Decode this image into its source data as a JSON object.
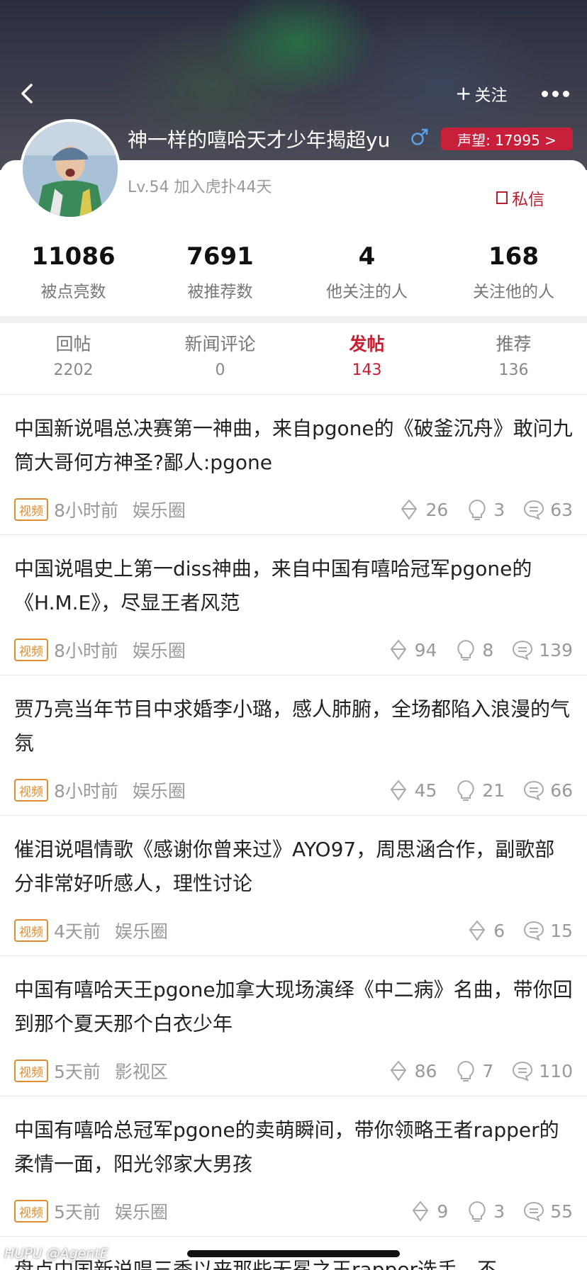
{
  "header": {
    "follow_label": "关注",
    "username": "神一样的嘻哈天才少年揭超yu",
    "reputation_label": "声望: 17995 >",
    "level_line": "Lv.54 加入虎扑44天",
    "dm_label": "私信"
  },
  "stats": [
    {
      "num": "11086",
      "label": "被点亮数"
    },
    {
      "num": "7691",
      "label": "被推荐数"
    },
    {
      "num": "4",
      "label": "他关注的人"
    },
    {
      "num": "168",
      "label": "关注他的人"
    }
  ],
  "tabs": [
    {
      "label": "回帖",
      "count": "2202"
    },
    {
      "label": "新闻评论",
      "count": "0"
    },
    {
      "label": "发帖",
      "count": "143"
    },
    {
      "label": "推荐",
      "count": "136"
    }
  ],
  "active_tab": "发帖",
  "posts": [
    {
      "title": "中国新说唱总决赛第一神曲，来自pgone的《破釜沉舟》敢问九筒大哥何方神圣?鄙人:pgone",
      "tag": "视频",
      "time": "8小时前",
      "section": "娱乐圈",
      "recommend": "26",
      "light": "3",
      "replies": "63"
    },
    {
      "title": "中国说唱史上第一diss神曲，来自中国有嘻哈冠军pgone的《H.M.E》，尽显王者风范",
      "tag": "视频",
      "time": "8小时前",
      "section": "娱乐圈",
      "recommend": "94",
      "light": "8",
      "replies": "139"
    },
    {
      "title": "贾乃亮当年节目中求婚李小璐，感人肺腑，全场都陷入浪漫的气氛",
      "tag": "视频",
      "time": "8小时前",
      "section": "娱乐圈",
      "recommend": "45",
      "light": "21",
      "replies": "66"
    },
    {
      "title": "催泪说唱情歌《感谢你曾来过》AYO97，周思涵合作，副歌部分非常好听感人，理性讨论",
      "tag": "视频",
      "time": "4天前",
      "section": "娱乐圈",
      "recommend": "6",
      "light": "",
      "replies": "15"
    },
    {
      "title": "中国有嘻哈天王pgone加拿大现场演绎《中二病》名曲，带你回到那个夏天那个白衣少年",
      "tag": "视频",
      "time": "5天前",
      "section": "影视区",
      "recommend": "86",
      "light": "7",
      "replies": "110"
    },
    {
      "title": "中国有嘻哈总冠军pgone的卖萌瞬间，带你领略王者rapper的柔情一面，阳光邻家大男孩",
      "tag": "视频",
      "time": "5天前",
      "section": "娱乐圈",
      "recommend": "9",
      "light": "3",
      "replies": "55"
    }
  ],
  "partial_post_title": "盘点中国新说唱三季以来那些无冕之王rapper选手，不",
  "watermark": "HUPU @AgentE",
  "colors": {
    "accent_red": "#c81f33",
    "video_tag": "#e08c2f",
    "badge_red": "#c8203a"
  },
  "icons": [
    "back-arrow-icon",
    "more-dots-icon",
    "male-gender-icon",
    "message-icon",
    "recommend-icon",
    "light-bulb-icon",
    "reply-bubble-icon"
  ]
}
